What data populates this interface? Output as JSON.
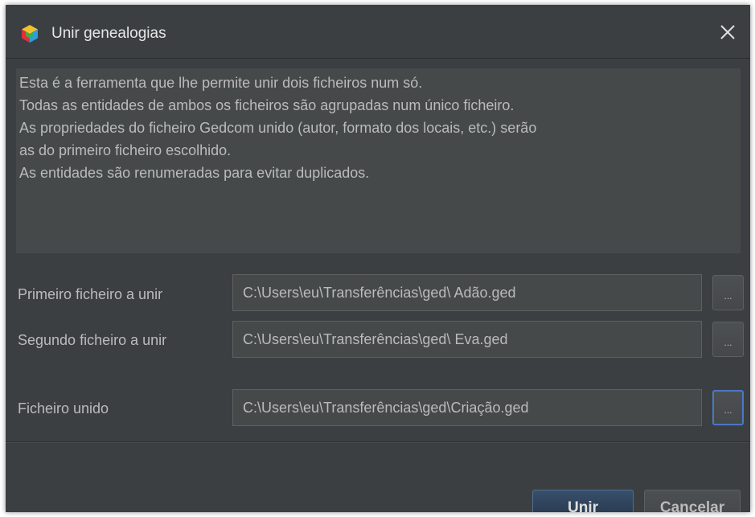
{
  "dialog": {
    "title": "Unir genealogias",
    "close_glyph": "✕",
    "icon": "app-logo-icon"
  },
  "description": {
    "lines": [
      "Esta é a ferramenta que lhe permite unir dois ficheiros num só.",
      "Todas as entidades de ambos os ficheiros são agrupadas num único ficheiro.",
      "As propriedades do ficheiro Gedcom unido (autor, formato dos locais, etc.) serão",
      "as do primeiro ficheiro escolhido.",
      "As entidades são renumeradas para evitar duplicados."
    ]
  },
  "fields": {
    "first": {
      "label": "Primeiro ficheiro a unir",
      "value": "C:\\Users\\eu\\Transferências\\ged\\ Adão.ged",
      "browse_label": "..."
    },
    "second": {
      "label": "Segundo ficheiro a unir",
      "value": "C:\\Users\\eu\\Transferências\\ged\\ Eva.ged",
      "browse_label": "..."
    },
    "merged": {
      "label": "Ficheiro unido",
      "value": "C:\\Users\\eu\\Transferências\\ged\\Criação.ged",
      "browse_label": "..."
    }
  },
  "buttons": {
    "merge": "Unir",
    "cancel": "Cancelar"
  },
  "colors": {
    "window_bg": "#3c3f41",
    "field_bg": "#45494a",
    "text": "#bbbbbb",
    "focus_accent": "#4b77c3"
  }
}
